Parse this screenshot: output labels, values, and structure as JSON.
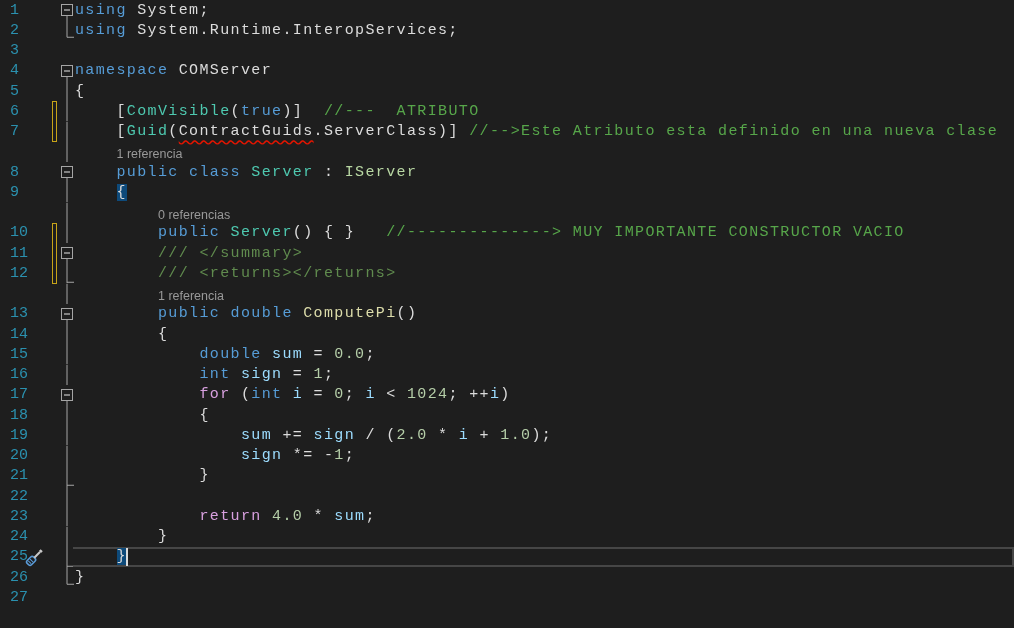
{
  "rows": [
    {
      "kind": "code",
      "number": "1",
      "fold": {
        "kind": "box"
      },
      "changed": false,
      "current": false,
      "tokens": [
        {
          "kind": "kw",
          "text": "using"
        },
        {
          "kind": "plain",
          "text": " System;"
        }
      ]
    },
    {
      "kind": "code",
      "number": "2",
      "fold": {
        "kind": "end"
      },
      "changed": false,
      "current": false,
      "tokens": [
        {
          "kind": "kw",
          "text": "using"
        },
        {
          "kind": "plain",
          "text": " System.Runtime.InteropServices;"
        }
      ]
    },
    {
      "kind": "code",
      "number": "3",
      "changed": false,
      "current": false
    },
    {
      "kind": "code",
      "number": "4",
      "fold": {
        "kind": "box"
      },
      "changed": false,
      "current": false,
      "tokens": [
        {
          "kind": "kw",
          "text": "namespace"
        },
        {
          "kind": "plain",
          "text": " COMServer"
        }
      ]
    },
    {
      "kind": "code",
      "number": "5",
      "fold": {
        "kind": "bar"
      },
      "changed": false,
      "current": false,
      "tokens": [
        {
          "kind": "plain",
          "text": "{"
        }
      ]
    },
    {
      "kind": "code",
      "number": "6",
      "fold": {
        "kind": "bar"
      },
      "changed": true,
      "current": false,
      "tokens": [
        {
          "kind": "plain",
          "text": "    ["
        },
        {
          "kind": "type",
          "text": "ComVisible"
        },
        {
          "kind": "plain",
          "text": "("
        },
        {
          "kind": "kw",
          "text": "true"
        },
        {
          "kind": "plain",
          "text": ")]"
        },
        {
          "kind": "comment",
          "text": "  //---  ATRIBUTO"
        }
      ]
    },
    {
      "kind": "code",
      "number": "7",
      "fold": {
        "kind": "bar"
      },
      "changed": true,
      "current": false,
      "tokens": [
        {
          "kind": "plain",
          "text": "    ["
        },
        {
          "kind": "type",
          "text": "Guid"
        },
        {
          "kind": "plain",
          "text": "("
        },
        {
          "kind": "error",
          "text": "ContractGuids"
        },
        {
          "kind": "plain",
          "text": ".ServerClass)]"
        },
        {
          "kind": "comment",
          "text": " //-->Este Atributo esta definido en una nueva clase"
        }
      ]
    },
    {
      "kind": "lens",
      "text": "1 referencia"
    },
    {
      "kind": "code",
      "number": "8",
      "fold": {
        "kind": "box"
      },
      "changed": false,
      "current": false,
      "tokens": [
        {
          "kind": "kw",
          "text": "    public"
        },
        {
          "kind": "kw",
          "text": " class"
        },
        {
          "kind": "type",
          "text": " Server"
        },
        {
          "kind": "plain",
          "text": " :"
        },
        {
          "kind": "iface",
          "text": " IServer"
        }
      ]
    },
    {
      "kind": "code",
      "number": "9",
      "fold": {
        "kind": "bar"
      },
      "changed": false,
      "current": false,
      "tokens": [
        {
          "kind": "brace",
          "text": "    {"
        }
      ]
    },
    {
      "kind": "lens",
      "text": "0 referencias"
    },
    {
      "kind": "code",
      "number": "10",
      "fold": {
        "kind": "bar"
      },
      "changed": true,
      "current": false,
      "tokens": [
        {
          "kind": "kw",
          "text": "        public"
        },
        {
          "kind": "type",
          "text": " Server"
        },
        {
          "kind": "plain",
          "text": "() { }"
        },
        {
          "kind": "comment",
          "text": "   //--------------> MUY IMPORTANTE CONSTRUCTOR VACIO"
        }
      ]
    },
    {
      "kind": "code",
      "number": "11",
      "fold": {
        "kind": "box"
      },
      "changed": true,
      "current": false,
      "tokens": [
        {
          "kind": "doc",
          "text": "        /// </summary>"
        }
      ]
    },
    {
      "kind": "code",
      "number": "12",
      "fold": {
        "kind": "endbar"
      },
      "changed": true,
      "current": false,
      "tokens": [
        {
          "kind": "doc",
          "text": "        /// <returns></returns>"
        }
      ]
    },
    {
      "kind": "lens",
      "text": "1 referencia"
    },
    {
      "kind": "code",
      "number": "13",
      "fold": {
        "kind": "box"
      },
      "changed": false,
      "current": false,
      "tokens": [
        {
          "kind": "kw",
          "text": "        public"
        },
        {
          "kind": "kw",
          "text": " double"
        },
        {
          "kind": "method",
          "text": " ComputePi"
        },
        {
          "kind": "plain",
          "text": "()"
        }
      ]
    },
    {
      "kind": "code",
      "number": "14",
      "fold": {
        "kind": "bar"
      },
      "changed": false,
      "current": false,
      "tokens": [
        {
          "kind": "plain",
          "text": "        {"
        }
      ]
    },
    {
      "kind": "code",
      "number": "15",
      "fold": {
        "kind": "bar"
      },
      "changed": false,
      "current": false,
      "tokens": [
        {
          "kind": "kw",
          "text": "            double"
        },
        {
          "kind": "var",
          "text": " sum"
        },
        {
          "kind": "plain",
          "text": " ="
        },
        {
          "kind": "num",
          "text": " 0.0"
        },
        {
          "kind": "plain",
          "text": ";"
        }
      ]
    },
    {
      "kind": "code",
      "number": "16",
      "fold": {
        "kind": "bar"
      },
      "changed": false,
      "current": false,
      "tokens": [
        {
          "kind": "kw",
          "text": "            int"
        },
        {
          "kind": "var",
          "text": " sign"
        },
        {
          "kind": "plain",
          "text": " ="
        },
        {
          "kind": "num",
          "text": " 1"
        },
        {
          "kind": "plain",
          "text": ";"
        }
      ]
    },
    {
      "kind": "code",
      "number": "17",
      "fold": {
        "kind": "box"
      },
      "changed": false,
      "current": false,
      "tokens": [
        {
          "kind": "control",
          "text": "            for"
        },
        {
          "kind": "plain",
          "text": " ("
        },
        {
          "kind": "kw",
          "text": "int"
        },
        {
          "kind": "var",
          "text": " i"
        },
        {
          "kind": "plain",
          "text": " ="
        },
        {
          "kind": "num",
          "text": " 0"
        },
        {
          "kind": "plain",
          "text": ";"
        },
        {
          "kind": "var",
          "text": " i"
        },
        {
          "kind": "plain",
          "text": " <"
        },
        {
          "kind": "num",
          "text": " 1024"
        },
        {
          "kind": "plain",
          "text": "; ++"
        },
        {
          "kind": "var",
          "text": "i"
        },
        {
          "kind": "plain",
          "text": ")"
        }
      ]
    },
    {
      "kind": "code",
      "number": "18",
      "fold": {
        "kind": "bar"
      },
      "changed": false,
      "current": false,
      "tokens": [
        {
          "kind": "plain",
          "text": "            {"
        }
      ]
    },
    {
      "kind": "code",
      "number": "19",
      "fold": {
        "kind": "bar"
      },
      "changed": false,
      "current": false,
      "tokens": [
        {
          "kind": "var",
          "text": "                sum"
        },
        {
          "kind": "plain",
          "text": " +="
        },
        {
          "kind": "var",
          "text": " sign"
        },
        {
          "kind": "plain",
          "text": " / ("
        },
        {
          "kind": "num",
          "text": "2.0"
        },
        {
          "kind": "plain",
          "text": " *"
        },
        {
          "kind": "var",
          "text": " i"
        },
        {
          "kind": "plain",
          "text": " +"
        },
        {
          "kind": "num",
          "text": " 1.0"
        },
        {
          "kind": "plain",
          "text": ");"
        }
      ]
    },
    {
      "kind": "code",
      "number": "20",
      "fold": {
        "kind": "bar"
      },
      "changed": false,
      "current": false,
      "tokens": [
        {
          "kind": "var",
          "text": "                sign"
        },
        {
          "kind": "plain",
          "text": " *= -"
        },
        {
          "kind": "num",
          "text": "1"
        },
        {
          "kind": "plain",
          "text": ";"
        }
      ]
    },
    {
      "kind": "code",
      "number": "21",
      "fold": {
        "kind": "endbar"
      },
      "changed": false,
      "current": false,
      "tokens": [
        {
          "kind": "plain",
          "text": "            }"
        }
      ]
    },
    {
      "kind": "code",
      "number": "22",
      "fold": {
        "kind": "bar"
      },
      "changed": false,
      "current": false
    },
    {
      "kind": "code",
      "number": "23",
      "fold": {
        "kind": "bar"
      },
      "changed": false,
      "current": false,
      "tokens": [
        {
          "kind": "control",
          "text": "            return"
        },
        {
          "kind": "num",
          "text": " 4.0"
        },
        {
          "kind": "plain",
          "text": " *"
        },
        {
          "kind": "var",
          "text": " sum"
        },
        {
          "kind": "plain",
          "text": ";"
        }
      ]
    },
    {
      "kind": "code",
      "number": "24",
      "fold": {
        "kind": "bar"
      },
      "changed": false,
      "current": false,
      "tokens": [
        {
          "kind": "plain",
          "text": "        }"
        }
      ]
    },
    {
      "kind": "code",
      "number": "25",
      "fold": {
        "kind": "endbar"
      },
      "changed": false,
      "current": true,
      "gutter_icon": {
        "kind": "screwdriver"
      },
      "tokens": [
        {
          "kind": "brace",
          "text": "    }"
        }
      ]
    },
    {
      "kind": "code",
      "number": "26",
      "fold": {
        "kind": "end"
      },
      "changed": false,
      "current": false,
      "tokens": [
        {
          "kind": "plain",
          "text": "}"
        }
      ]
    },
    {
      "kind": "code",
      "number": "27",
      "changed": false,
      "current": false
    }
  ]
}
